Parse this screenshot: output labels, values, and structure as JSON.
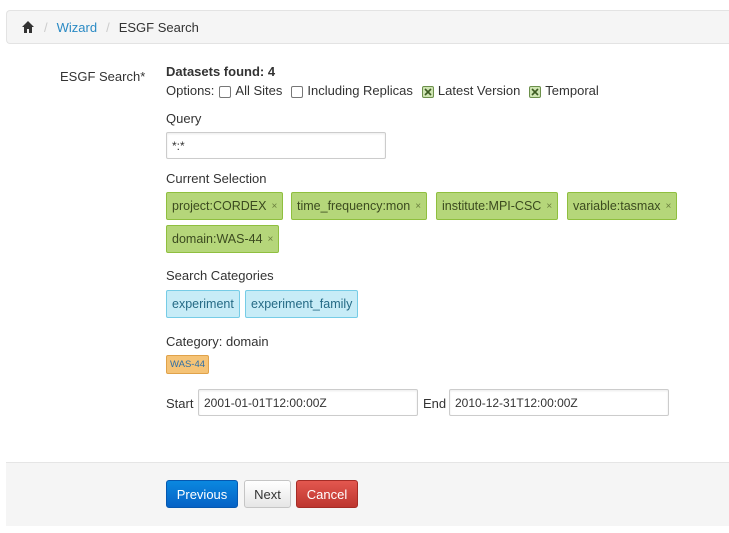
{
  "breadcrumb": {
    "items": [
      {
        "label": "Wizard"
      },
      {
        "label": "ESGF Search"
      }
    ]
  },
  "form": {
    "field_label": "ESGF Search*",
    "datasets_found": "Datasets found: 4",
    "options_label": "Options:",
    "options": [
      {
        "label": "All Sites",
        "checked": false
      },
      {
        "label": "Including Replicas",
        "checked": false
      },
      {
        "label": "Latest Version",
        "checked": true
      },
      {
        "label": "Temporal",
        "checked": true
      }
    ],
    "query_label": "Query",
    "query_value": "*:*",
    "current_selection_label": "Current Selection",
    "selection_tags": [
      {
        "label": "project:CORDEX",
        "remove": "×"
      },
      {
        "label": "time_frequency:mon",
        "remove": "×"
      },
      {
        "label": "institute:MPI-CSC",
        "remove": "×"
      },
      {
        "label": "variable:tasmax",
        "remove": "×"
      },
      {
        "label": "domain:WAS-44",
        "remove": "×"
      }
    ],
    "search_categories_label": "Search Categories",
    "categories": [
      {
        "label": "experiment"
      },
      {
        "label": "experiment_family"
      }
    ],
    "category_label": "Category: domain",
    "category_values": [
      {
        "label": "WAS-44"
      }
    ],
    "start_label": "Start",
    "start_value": "2001-01-01T12:00:00Z",
    "end_label": "End",
    "end_value": "2010-12-31T12:00:00Z"
  },
  "buttons": {
    "previous": "Previous",
    "next": "Next",
    "cancel": "Cancel"
  },
  "colors": {
    "link": "#2a8ac4",
    "selection_tag": "#b5d67a",
    "category_tag": "#c7ecf7",
    "value_tag": "#f5c376",
    "primary_button": "#0662c6",
    "danger_button": "#bd362f"
  }
}
